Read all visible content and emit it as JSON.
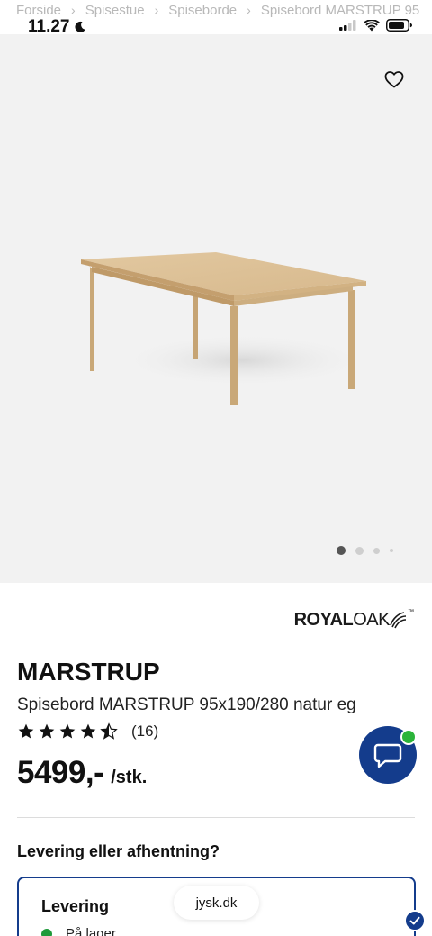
{
  "breadcrumb": {
    "items": [
      "Forside",
      "Spisestue",
      "Spiseborde",
      "Spisebord MARSTRUP 95"
    ],
    "separator": "›"
  },
  "status_bar": {
    "time": "11.27"
  },
  "gallery": {
    "image_count": 4,
    "active_index": 0
  },
  "brand": {
    "part1": "ROYAL",
    "part2": "OAK",
    "tm": "™"
  },
  "product": {
    "title": "MARSTRUP",
    "subtitle": "Spisebord MARSTRUP 95x190/280 natur eg",
    "rating_value": 4.5,
    "review_count": "(16)",
    "price": "5499,-",
    "unit": "/stk."
  },
  "delivery": {
    "heading": "Levering eller afhentning?",
    "card_title": "Levering",
    "stock_label": "På lager"
  },
  "browser": {
    "url": "jysk.dk"
  },
  "colors": {
    "brand_blue": "#143c8c",
    "online_green": "#2bb43a",
    "stock_green": "#1f9a3a",
    "gallery_bg": "#f2f2f2"
  }
}
